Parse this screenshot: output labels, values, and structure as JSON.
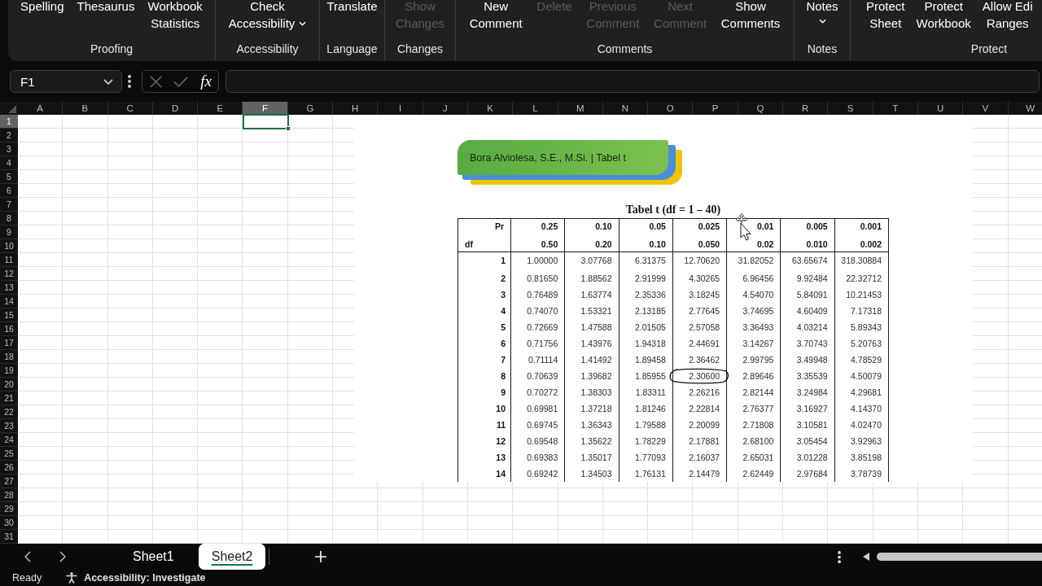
{
  "ribbon": {
    "groups": [
      {
        "label": "Proofing",
        "buttons": [
          {
            "lines": [
              "Spelling"
            ],
            "disabled": false,
            "dropdown": false
          },
          {
            "lines": [
              "Thesaurus"
            ],
            "disabled": false,
            "dropdown": false
          },
          {
            "lines": [
              "Workbook",
              "Statistics"
            ],
            "disabled": false,
            "dropdown": false
          }
        ]
      },
      {
        "label": "Accessibility",
        "buttons": [
          {
            "lines": [
              "Check",
              "Accessibility"
            ],
            "disabled": false,
            "dropdown": true
          }
        ]
      },
      {
        "label": "Language",
        "buttons": [
          {
            "lines": [
              "Translate"
            ],
            "disabled": false,
            "dropdown": false
          }
        ]
      },
      {
        "label": "Changes",
        "buttons": [
          {
            "lines": [
              "Show",
              "Changes"
            ],
            "disabled": true,
            "dropdown": false
          }
        ]
      },
      {
        "label": "Comments",
        "buttons": [
          {
            "lines": [
              "New",
              "Comment"
            ],
            "disabled": false,
            "dropdown": false
          },
          {
            "lines": [
              "Delete"
            ],
            "disabled": true,
            "dropdown": false
          },
          {
            "lines": [
              "Previous",
              "Comment"
            ],
            "disabled": true,
            "dropdown": false
          },
          {
            "lines": [
              "Next",
              "Comment"
            ],
            "disabled": true,
            "dropdown": false
          },
          {
            "lines": [
              "Show",
              "Comments"
            ],
            "disabled": false,
            "dropdown": false
          }
        ]
      },
      {
        "label": "Notes",
        "buttons": [
          {
            "lines": [
              "Notes"
            ],
            "disabled": false,
            "dropdown": true
          }
        ]
      },
      {
        "label": "Protect",
        "buttons": [
          {
            "lines": [
              "Protect",
              "Sheet"
            ],
            "disabled": false,
            "dropdown": false
          },
          {
            "lines": [
              "Protect",
              "Workbook"
            ],
            "disabled": false,
            "dropdown": false
          },
          {
            "lines": [
              "Allow Edi",
              "Ranges"
            ],
            "disabled": false,
            "dropdown": false
          }
        ]
      }
    ]
  },
  "formula_bar": {
    "name_box": "F1",
    "edit_buttons_disabled": true,
    "function_label": "fx"
  },
  "grid": {
    "columns": [
      {
        "label": "A",
        "selected": false
      },
      {
        "label": "B",
        "selected": false
      },
      {
        "label": "C",
        "selected": false
      },
      {
        "label": "D",
        "selected": false
      },
      {
        "label": "E",
        "selected": false
      },
      {
        "label": "F",
        "selected": true
      },
      {
        "label": "G",
        "selected": false
      },
      {
        "label": "H",
        "selected": false
      },
      {
        "label": "I",
        "selected": false
      },
      {
        "label": "J",
        "selected": false
      },
      {
        "label": "K",
        "selected": false
      },
      {
        "label": "L",
        "selected": false
      },
      {
        "label": "M",
        "selected": false
      },
      {
        "label": "N",
        "selected": false
      },
      {
        "label": "O",
        "selected": false
      },
      {
        "label": "P",
        "selected": false
      },
      {
        "label": "Q",
        "selected": false
      },
      {
        "label": "R",
        "selected": false
      },
      {
        "label": "S",
        "selected": false
      },
      {
        "label": "T",
        "selected": false
      },
      {
        "label": "U",
        "selected": false
      },
      {
        "label": "V",
        "selected": false
      },
      {
        "label": "W",
        "selected": false
      }
    ],
    "rows": [
      {
        "label": "1",
        "selected": true
      },
      {
        "label": "2",
        "selected": false
      },
      {
        "label": "3",
        "selected": false
      },
      {
        "label": "4",
        "selected": false
      },
      {
        "label": "5",
        "selected": false
      },
      {
        "label": "6",
        "selected": false
      },
      {
        "label": "7",
        "selected": false
      },
      {
        "label": "8",
        "selected": false
      },
      {
        "label": "9",
        "selected": false
      },
      {
        "label": "10",
        "selected": false
      },
      {
        "label": "11",
        "selected": false
      },
      {
        "label": "12",
        "selected": false
      },
      {
        "label": "13",
        "selected": false
      },
      {
        "label": "14",
        "selected": false
      },
      {
        "label": "15",
        "selected": false
      },
      {
        "label": "16",
        "selected": false
      },
      {
        "label": "17",
        "selected": false
      },
      {
        "label": "18",
        "selected": false
      },
      {
        "label": "19",
        "selected": false
      },
      {
        "label": "20",
        "selected": false
      },
      {
        "label": "21",
        "selected": false
      },
      {
        "label": "22",
        "selected": false
      },
      {
        "label": "23",
        "selected": false
      },
      {
        "label": "24",
        "selected": false
      },
      {
        "label": "25",
        "selected": false
      },
      {
        "label": "26",
        "selected": false
      },
      {
        "label": "27",
        "selected": false
      },
      {
        "label": "28",
        "selected": false
      },
      {
        "label": "29",
        "selected": false
      },
      {
        "label": "30",
        "selected": false
      },
      {
        "label": "31",
        "selected": false
      }
    ]
  },
  "picture": {
    "banner": "Bora Alviolesa, S.E., M.Si. | Tabel t",
    "table_title": "Tabel t (df = 1 – 40)",
    "table": {
      "pr_label": "Pr",
      "df_label": "df",
      "columns": [
        {
          "upper": "0.25",
          "lower": "0.50"
        },
        {
          "upper": "0.10",
          "lower": "0.20"
        },
        {
          "upper": "0.05",
          "lower": "0.10"
        },
        {
          "upper": "0.025",
          "lower": "0.050"
        },
        {
          "upper": "0.01",
          "lower": "0.02"
        },
        {
          "upper": "0.005",
          "lower": "0.010"
        },
        {
          "upper": "0.001",
          "lower": "0.002"
        }
      ],
      "rows": [
        {
          "df": "1",
          "cells": [
            {
              "text": "1.00000",
              "circled": false
            },
            {
              "text": "3.07768",
              "circled": false
            },
            {
              "text": "6.31375",
              "circled": false
            },
            {
              "text": "12.70620",
              "circled": false
            },
            {
              "text": "31.82052",
              "circled": false
            },
            {
              "text": "63.65674",
              "circled": false
            },
            {
              "text": "318.30884",
              "circled": false
            }
          ]
        },
        {
          "df": "2",
          "cells": [
            {
              "text": "0.81650",
              "circled": false
            },
            {
              "text": "1.88562",
              "circled": false
            },
            {
              "text": "2.91999",
              "circled": false
            },
            {
              "text": "4.30265",
              "circled": false
            },
            {
              "text": "6.96456",
              "circled": false
            },
            {
              "text": "9.92484",
              "circled": false
            },
            {
              "text": "22.32712",
              "circled": false
            }
          ]
        },
        {
          "df": "3",
          "cells": [
            {
              "text": "0.76489",
              "circled": false
            },
            {
              "text": "1.63774",
              "circled": false
            },
            {
              "text": "2.35336",
              "circled": false
            },
            {
              "text": "3.18245",
              "circled": false
            },
            {
              "text": "4.54070",
              "circled": false
            },
            {
              "text": "5.84091",
              "circled": false
            },
            {
              "text": "10.21453",
              "circled": false
            }
          ]
        },
        {
          "df": "4",
          "cells": [
            {
              "text": "0.74070",
              "circled": false
            },
            {
              "text": "1.53321",
              "circled": false
            },
            {
              "text": "2.13185",
              "circled": false
            },
            {
              "text": "2.77645",
              "circled": false
            },
            {
              "text": "3.74695",
              "circled": false
            },
            {
              "text": "4.60409",
              "circled": false
            },
            {
              "text": "7.17318",
              "circled": false
            }
          ]
        },
        {
          "df": "5",
          "cells": [
            {
              "text": "0.72669",
              "circled": false
            },
            {
              "text": "1.47588",
              "circled": false
            },
            {
              "text": "2.01505",
              "circled": false
            },
            {
              "text": "2.57058",
              "circled": false
            },
            {
              "text": "3.36493",
              "circled": false
            },
            {
              "text": "4.03214",
              "circled": false
            },
            {
              "text": "5.89343",
              "circled": false
            }
          ]
        },
        {
          "df": "6",
          "cells": [
            {
              "text": "0.71756",
              "circled": false
            },
            {
              "text": "1.43976",
              "circled": false
            },
            {
              "text": "1.94318",
              "circled": false
            },
            {
              "text": "2.44691",
              "circled": false
            },
            {
              "text": "3.14267",
              "circled": false
            },
            {
              "text": "3.70743",
              "circled": false
            },
            {
              "text": "5.20763",
              "circled": false
            }
          ]
        },
        {
          "df": "7",
          "cells": [
            {
              "text": "0.71114",
              "circled": false
            },
            {
              "text": "1.41492",
              "circled": false
            },
            {
              "text": "1.89458",
              "circled": false
            },
            {
              "text": "2.36462",
              "circled": false
            },
            {
              "text": "2.99795",
              "circled": false
            },
            {
              "text": "3.49948",
              "circled": false
            },
            {
              "text": "4.78529",
              "circled": false
            }
          ]
        },
        {
          "df": "8",
          "cells": [
            {
              "text": "0.70639",
              "circled": false
            },
            {
              "text": "1.39682",
              "circled": false
            },
            {
              "text": "1.85955",
              "circled": false
            },
            {
              "text": "2.30600",
              "circled": true
            },
            {
              "text": "2.89646",
              "circled": false
            },
            {
              "text": "3.35539",
              "circled": false
            },
            {
              "text": "4.50079",
              "circled": false
            }
          ]
        },
        {
          "df": "9",
          "cells": [
            {
              "text": "0.70272",
              "circled": false
            },
            {
              "text": "1.38303",
              "circled": false
            },
            {
              "text": "1.83311",
              "circled": false
            },
            {
              "text": "2.26216",
              "circled": false
            },
            {
              "text": "2.82144",
              "circled": false
            },
            {
              "text": "3.24984",
              "circled": false
            },
            {
              "text": "4.29681",
              "circled": false
            }
          ]
        },
        {
          "df": "10",
          "cells": [
            {
              "text": "0.69981",
              "circled": false
            },
            {
              "text": "1.37218",
              "circled": false
            },
            {
              "text": "1.81246",
              "circled": false
            },
            {
              "text": "2.22814",
              "circled": false
            },
            {
              "text": "2.76377",
              "circled": false
            },
            {
              "text": "3.16927",
              "circled": false
            },
            {
              "text": "4.14370",
              "circled": false
            }
          ]
        },
        {
          "df": "11",
          "cells": [
            {
              "text": "0.69745",
              "circled": false
            },
            {
              "text": "1.36343",
              "circled": false
            },
            {
              "text": "1.79588",
              "circled": false
            },
            {
              "text": "2.20099",
              "circled": false
            },
            {
              "text": "2.71808",
              "circled": false
            },
            {
              "text": "3.10581",
              "circled": false
            },
            {
              "text": "4.02470",
              "circled": false
            }
          ]
        },
        {
          "df": "12",
          "cells": [
            {
              "text": "0.69548",
              "circled": false
            },
            {
              "text": "1.35622",
              "circled": false
            },
            {
              "text": "1.78229",
              "circled": false
            },
            {
              "text": "2.17881",
              "circled": false
            },
            {
              "text": "2.68100",
              "circled": false
            },
            {
              "text": "3.05454",
              "circled": false
            },
            {
              "text": "3.92963",
              "circled": false
            }
          ]
        },
        {
          "df": "13",
          "cells": [
            {
              "text": "0.69383",
              "circled": false
            },
            {
              "text": "1.35017",
              "circled": false
            },
            {
              "text": "1.77093",
              "circled": false
            },
            {
              "text": "2.16037",
              "circled": false
            },
            {
              "text": "2.65031",
              "circled": false
            },
            {
              "text": "3.01228",
              "circled": false
            },
            {
              "text": "3.85198",
              "circled": false
            }
          ]
        },
        {
          "df": "14",
          "cells": [
            {
              "text": "0.69242",
              "circled": false
            },
            {
              "text": "1.34503",
              "circled": false
            },
            {
              "text": "1.76131",
              "circled": false
            },
            {
              "text": "2.14479",
              "circled": false
            },
            {
              "text": "2.62449",
              "circled": false
            },
            {
              "text": "2.97684",
              "circled": false
            },
            {
              "text": "3.78739",
              "circled": false
            }
          ]
        }
      ]
    }
  },
  "sheet_tabs": [
    {
      "label": "Sheet1",
      "selected": false
    },
    {
      "label": "Sheet2",
      "selected": true
    }
  ],
  "status_bar": {
    "mode": "Ready",
    "accessibility": "Accessibility: Investigate"
  }
}
